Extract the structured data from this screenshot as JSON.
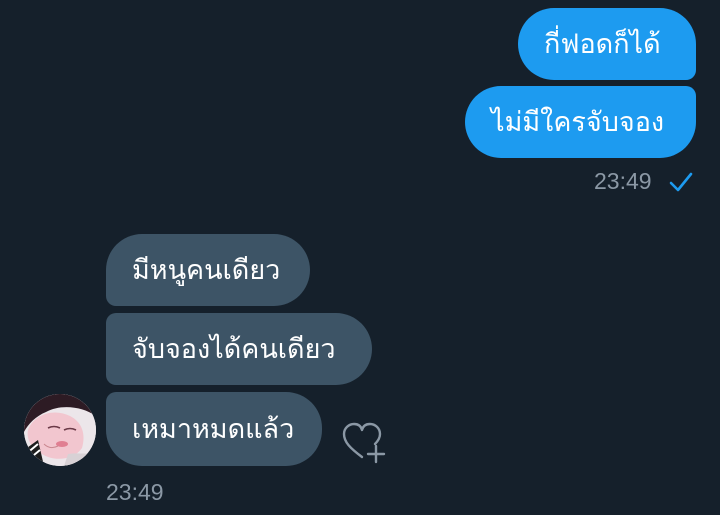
{
  "sent": {
    "messages": [
      "กี่ฟอดก็ได้",
      "ไม่มีใครจับจอง"
    ],
    "time": "23:49",
    "status_icon": "check-icon"
  },
  "received": {
    "messages": [
      "มีหนูคนเดียว",
      "จับจองได้คนเดียว",
      "เหมาหมดแล้ว"
    ],
    "time": "23:49",
    "reaction_icon": "heart-add-icon"
  },
  "colors": {
    "background": "#15202b",
    "sent_bubble": "#1d9bf0",
    "received_bubble": "#3d5466",
    "timestamp": "#8b98a5"
  }
}
